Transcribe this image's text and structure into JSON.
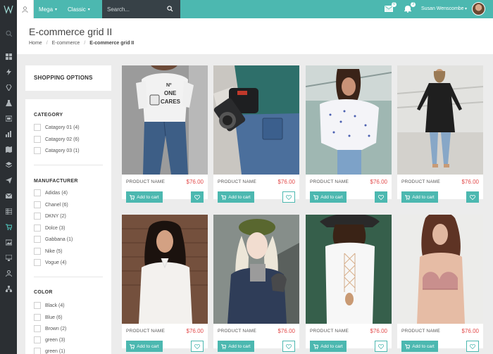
{
  "topbar": {
    "logo": "W",
    "menu": [
      "Mega",
      "Classic"
    ],
    "search_placeholder": "Search...",
    "mail_count": "6",
    "bell_count": "3",
    "user_name": "Susan Wenscombe"
  },
  "header": {
    "title": "E-commerce grid II",
    "breadcrumb": [
      "Home",
      "E-commerce",
      "E-commerce grid II"
    ]
  },
  "filters": {
    "title": "SHOPPING OPTIONS",
    "category": {
      "title": "CATEGORY",
      "options": [
        "Catagory 01 (4)",
        "Catagory 02 (6)",
        "Catagory 03 (1)"
      ]
    },
    "manufacturer": {
      "title": "MANUFACTURER",
      "options": [
        "Adidas (4)",
        "Chanel (6)",
        "DKNY (2)",
        "Dolce (3)",
        "Gabbana (1)",
        "Nike (5)",
        "Vogue (4)"
      ]
    },
    "color": {
      "title": "COLOR",
      "options": [
        "Black (4)",
        "Blue (6)",
        "Brown (2)",
        "green (3)",
        "green (1)"
      ]
    }
  },
  "products": [
    {
      "name": "PRODUCT NAME",
      "price": "$76.00",
      "cart": "Add to cart"
    },
    {
      "name": "PRODUCT NAME",
      "price": "$76.00",
      "cart": "Add to cart"
    },
    {
      "name": "PRODUCT NAME",
      "price": "$76.00",
      "cart": "Add to cart"
    },
    {
      "name": "PRODUCT NAME",
      "price": "$76.00",
      "cart": "Add to cart"
    },
    {
      "name": "PRODUCT NAME",
      "price": "$76.00",
      "cart": "Add to cart"
    },
    {
      "name": "PRODUCT NAME",
      "price": "$76.00",
      "cart": "Add to cart"
    },
    {
      "name": "PRODUCT NAME",
      "price": "$76.00",
      "cart": "Add to cart"
    },
    {
      "name": "PRODUCT NAME",
      "price": "$76.00",
      "cart": "Add to cart"
    }
  ],
  "tshirt_print": [
    "Nº",
    "ONE",
    "CARES"
  ],
  "colors": {
    "accent": "#4cb8b0",
    "sidebar": "#2b2f33",
    "price": "#e24b4b"
  },
  "sidebar_icons": [
    "search-icon",
    "grid-icon",
    "bolt-icon",
    "diamond-icon",
    "flask-icon",
    "layers-icon",
    "chart-icon",
    "map-icon",
    "stack-icon",
    "send-icon",
    "mail-icon",
    "table-icon",
    "cart-icon",
    "image-icon",
    "monitor-icon",
    "user-icon",
    "sitemap-icon"
  ]
}
